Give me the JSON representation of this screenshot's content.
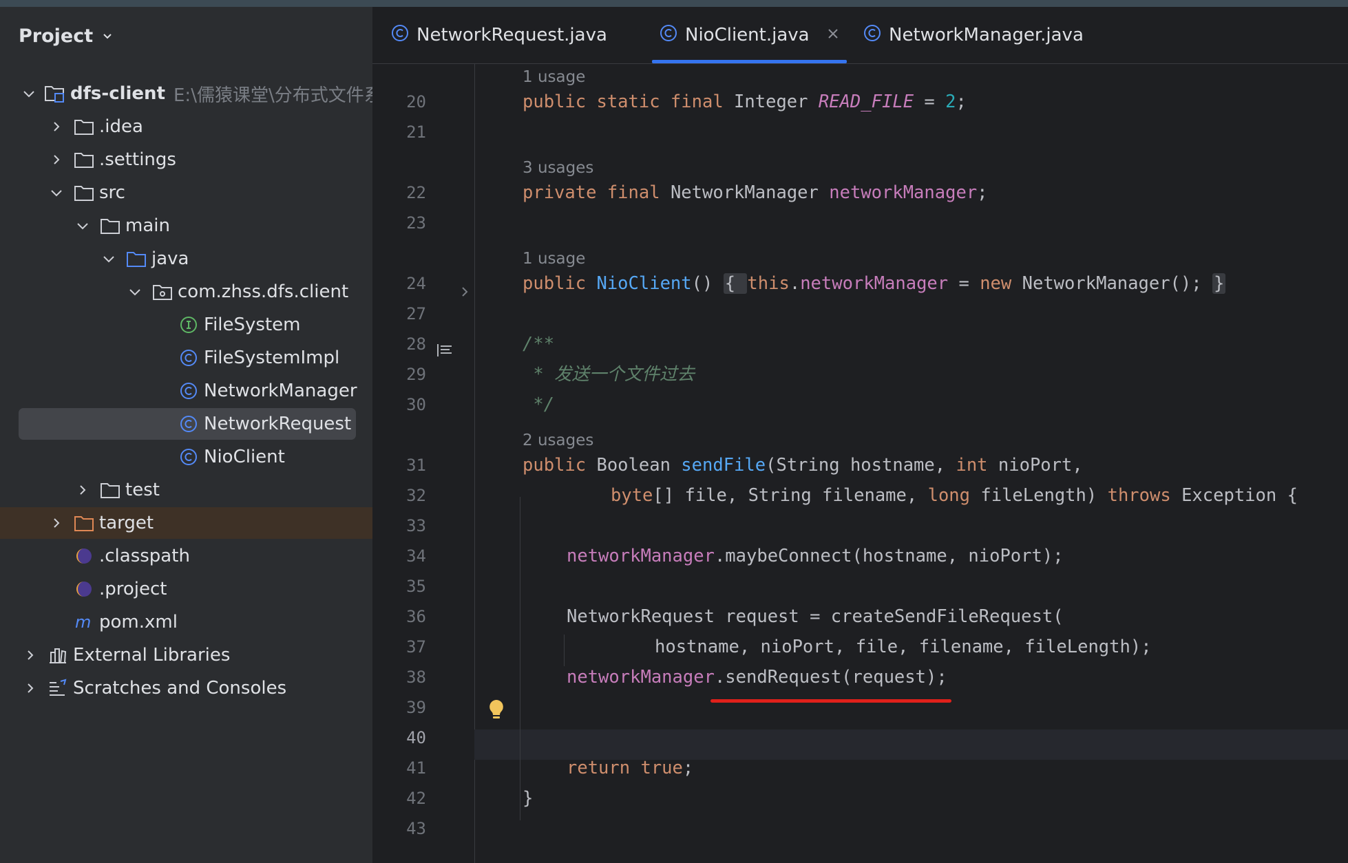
{
  "sidebar": {
    "title": "Project",
    "tree": [
      {
        "label": "dfs-client",
        "hint": "E:\\儒猿课堂\\分布式文件系",
        "icon": "module-folder-icon",
        "arrow": "expanded",
        "indent": 0
      },
      {
        "label": ".idea",
        "icon": "folder-icon",
        "arrow": "collapsed",
        "indent": 1
      },
      {
        "label": ".settings",
        "icon": "folder-icon",
        "arrow": "collapsed",
        "indent": 1
      },
      {
        "label": "src",
        "icon": "folder-icon",
        "arrow": "expanded",
        "indent": 1
      },
      {
        "label": "main",
        "icon": "folder-icon",
        "arrow": "expanded",
        "indent": 2
      },
      {
        "label": "java",
        "icon": "source-folder-icon",
        "arrow": "expanded",
        "indent": 3
      },
      {
        "label": "com.zhss.dfs.client",
        "icon": "package-icon",
        "arrow": "expanded",
        "indent": 4
      },
      {
        "label": "FileSystem",
        "icon": "interface-icon",
        "arrow": "none",
        "indent": 5
      },
      {
        "label": "FileSystemImpl",
        "icon": "class-icon",
        "arrow": "none",
        "indent": 5
      },
      {
        "label": "NetworkManager",
        "icon": "class-icon",
        "arrow": "none",
        "indent": 5
      },
      {
        "label": "NetworkRequest",
        "icon": "class-icon",
        "arrow": "none",
        "indent": 5,
        "selected": true
      },
      {
        "label": "NioClient",
        "icon": "class-icon",
        "arrow": "none",
        "indent": 5
      },
      {
        "label": "test",
        "icon": "folder-icon",
        "arrow": "collapsed",
        "indent": 2
      },
      {
        "label": "target",
        "icon": "excluded-folder-icon",
        "arrow": "collapsed",
        "indent": 1,
        "highlight": true
      },
      {
        "label": ".classpath",
        "icon": "eclipse-icon",
        "arrow": "none",
        "indent": 1
      },
      {
        "label": ".project",
        "icon": "eclipse-icon",
        "arrow": "none",
        "indent": 1
      },
      {
        "label": "pom.xml",
        "icon": "maven-icon",
        "arrow": "none",
        "indent": 1
      },
      {
        "label": "External Libraries",
        "icon": "library-icon",
        "arrow": "collapsed",
        "indent": 0
      },
      {
        "label": "Scratches and Consoles",
        "icon": "scratches-icon",
        "arrow": "collapsed",
        "indent": 0
      }
    ]
  },
  "tabs": [
    {
      "label": "NetworkRequest.java",
      "active": false
    },
    {
      "label": "NioClient.java",
      "active": true,
      "closable": true
    },
    {
      "label": "NetworkManager.java",
      "active": false
    }
  ],
  "editor": {
    "line_numbers": [
      "20",
      "21",
      "22",
      "23",
      "24",
      "27",
      "28",
      "29",
      "30",
      "31",
      "32",
      "33",
      "34",
      "35",
      "36",
      "37",
      "38",
      "39",
      "40",
      "41",
      "42",
      "43"
    ],
    "current_line": "40",
    "usages": [
      "1 usage",
      "3 usages",
      "1 usage",
      "2 usages"
    ],
    "code": {
      "l20": [
        [
          "kw",
          "public static final "
        ],
        [
          "",
          "Integer "
        ],
        [
          "const",
          "READ_FILE"
        ],
        [
          "",
          " = "
        ],
        [
          "num",
          "2"
        ],
        [
          "",
          ";"
        ]
      ],
      "l22": [
        [
          "kw",
          "private final "
        ],
        [
          "",
          "NetworkManager "
        ],
        [
          "fld",
          "networkManager"
        ],
        [
          "",
          ";"
        ]
      ],
      "l24": [
        [
          "kw",
          "public "
        ],
        [
          "fn",
          "NioClient"
        ],
        [
          "",
          "() "
        ],
        [
          "fold",
          "{ "
        ],
        [
          "kw",
          "this"
        ],
        [
          "",
          "."
        ],
        [
          "fld",
          "networkManager"
        ],
        [
          "",
          " = "
        ],
        [
          "kw",
          "new "
        ],
        [
          "",
          "NetworkManager(); "
        ],
        [
          "fold",
          "}"
        ]
      ],
      "l28": [
        [
          "doc",
          "/**"
        ]
      ],
      "l29": [
        [
          "doc",
          " * 发送一个文件过去"
        ]
      ],
      "l30": [
        [
          "doc",
          " */"
        ]
      ],
      "l31": [
        [
          "kw",
          "public "
        ],
        [
          "",
          "Boolean "
        ],
        [
          "fn",
          "sendFile"
        ],
        [
          "",
          "(String hostname, "
        ],
        [
          "kw",
          "int "
        ],
        [
          "",
          "nioPort,"
        ]
      ],
      "l32": [
        [
          "kw",
          "byte"
        ],
        [
          "",
          "[] file, String filename, "
        ],
        [
          "kw",
          "long "
        ],
        [
          "",
          "fileLength) "
        ],
        [
          "kw",
          "throws "
        ],
        [
          "",
          "Exception {"
        ]
      ],
      "l34": [
        [
          "fld",
          "networkManager"
        ],
        [
          "",
          ".maybeConnect(hostname, nioPort);"
        ]
      ],
      "l36": [
        [
          "",
          "NetworkRequest request = createSendFileRequest("
        ]
      ],
      "l37": [
        [
          "",
          "hostname, nioPort, file, filename, fileLength);"
        ]
      ],
      "l38": [
        [
          "fld",
          "networkManager"
        ],
        [
          "",
          ".sendRequest(request);"
        ]
      ],
      "l41": [
        [
          "kw",
          "return true"
        ],
        [
          "",
          ";"
        ]
      ],
      "l42": [
        [
          "",
          "}"
        ]
      ]
    }
  },
  "colors": {
    "keyword": "#cf8e6d",
    "field": "#c77dbb",
    "method": "#56a8f5",
    "number": "#2aacb8",
    "doc": "#5f826b",
    "underline": "#e0201a"
  }
}
